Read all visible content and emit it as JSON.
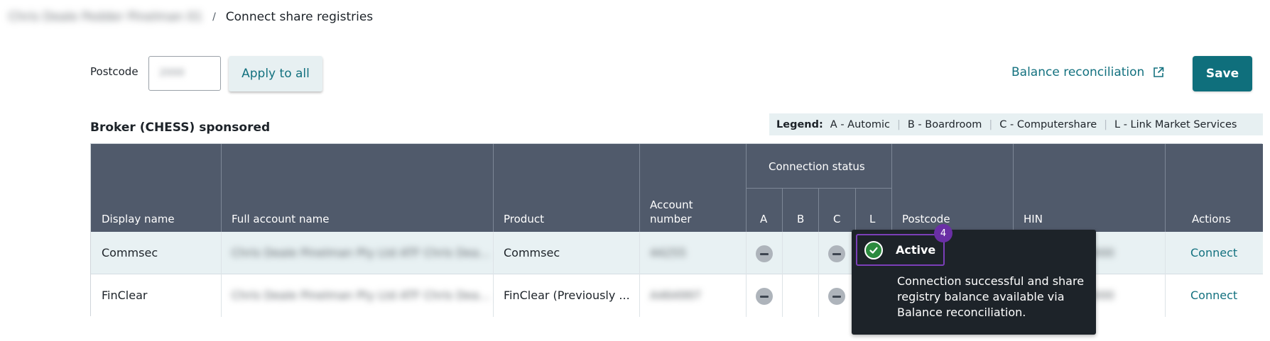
{
  "breadcrumb": {
    "parent": "Chris Deale Pedder Pinelman 01",
    "separator": "/",
    "current": "Connect share registries"
  },
  "toolbar": {
    "postcode_label": "Postcode",
    "postcode_value": "2000",
    "apply_label": "Apply to all",
    "balance_label": "Balance reconciliation",
    "save_label": "Save"
  },
  "section": {
    "title": "Broker (CHESS) sponsored"
  },
  "legend": {
    "title": "Legend:",
    "items": [
      "A - Automic",
      "B - Boardroom",
      "C - Computershare",
      "L - Link Market Services"
    ]
  },
  "table": {
    "headers": {
      "display_name": "Display name",
      "full_account_name": "Full account name",
      "product": "Product",
      "account_number_line1": "Account",
      "account_number_line2": "number",
      "connection_status": "Connection status",
      "status_a": "A",
      "status_b": "B",
      "status_c": "C",
      "status_l": "L",
      "postcode": "Postcode",
      "hin": "HIN",
      "actions": "Actions"
    },
    "rows": [
      {
        "display_name": "Commsec",
        "full_account_name": "Chris Deale Pinelman Pty Ltd ATF Chris Dea...",
        "product": "Commsec",
        "account_number": "44255",
        "hin": "0000",
        "action": "Connect"
      },
      {
        "display_name": "FinClear",
        "full_account_name": "Chris Deale Pinelman Pty Ltd ATF Chris Dea...",
        "product": "FinClear (Previously ...",
        "account_number": "A464997",
        "hin": "0000",
        "action": "Connect"
      }
    ]
  },
  "tooltip": {
    "badge": "4",
    "status": "Active",
    "description": "Connection successful and share registry balance available via Balance reconciliation."
  },
  "colors": {
    "accent": "#13717f",
    "header_bg": "#505a6b",
    "row_highlight": "#e8f1f3",
    "tooltip_bg": "#1d2329",
    "badge": "#6a2fa5",
    "active_green": "#2b8a3e"
  }
}
